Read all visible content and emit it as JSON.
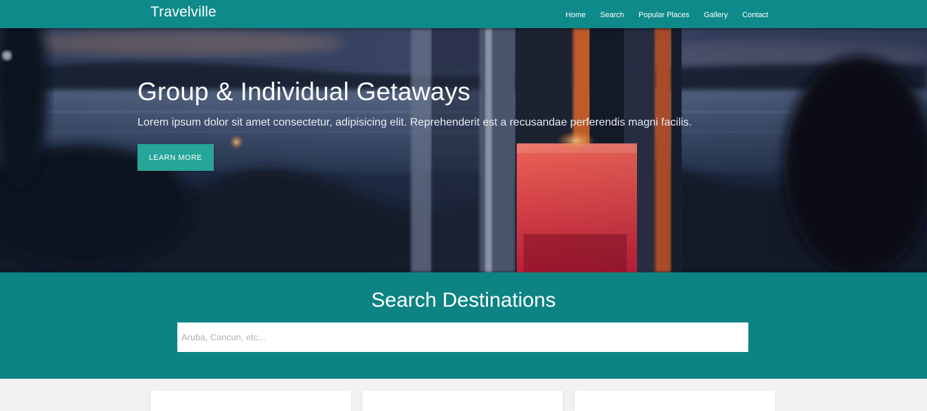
{
  "navbar": {
    "brand": "Travelville",
    "links": [
      "Home",
      "Search",
      "Popular Places",
      "Gallery",
      "Contact"
    ],
    "background": "#0f8a8a"
  },
  "hero": {
    "title": "Group & Individual Getaways",
    "text": "Lorem ipsum dolor sit amet consectetur, adipisicing elit. Reprehenderit est a recusandae perferendis magni facilis.",
    "button_label": "LEARN MORE",
    "button_color": "#26a69a"
  },
  "search": {
    "title": "Search Destinations",
    "placeholder": "Aruba, Cancun, etc...",
    "value": "",
    "background": "#0e8383"
  },
  "cards": {
    "count_visible": 3
  }
}
